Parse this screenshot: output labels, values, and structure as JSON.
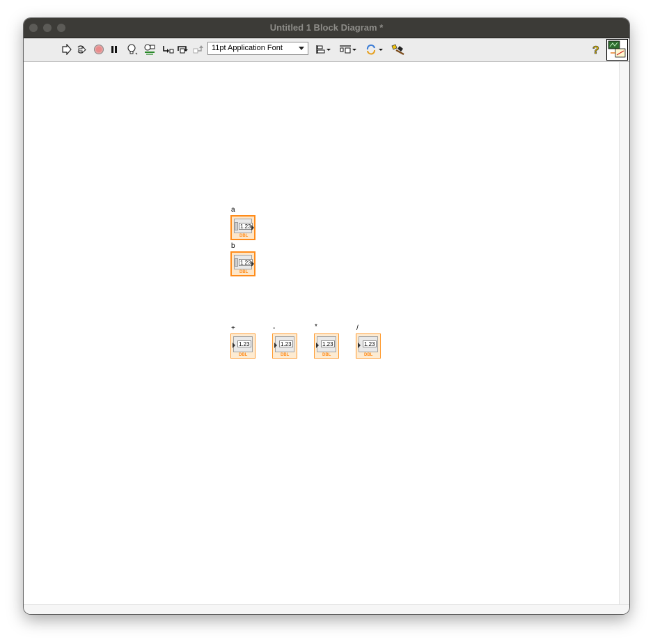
{
  "window": {
    "title": "Untitled 1 Block Diagram *"
  },
  "toolbar": {
    "icons": [
      {
        "name": "run-arrow-icon"
      },
      {
        "name": "run-continuously-icon"
      },
      {
        "name": "abort-execution-icon"
      },
      {
        "name": "pause-icon"
      },
      {
        "name": "highlight-execution-icon"
      },
      {
        "name": "retain-wire-values-icon"
      },
      {
        "name": "step-into-icon"
      },
      {
        "name": "step-over-icon"
      },
      {
        "name": "step-out-icon"
      },
      {
        "name": "align-objects-icon"
      },
      {
        "name": "distribute-objects-icon"
      },
      {
        "name": "reorder-icon"
      },
      {
        "name": "cleanup-diagram-icon"
      },
      {
        "name": "context-help-icon"
      }
    ],
    "font_select": {
      "value": "11pt Application Font"
    }
  },
  "diagram": {
    "controls": [
      {
        "label": "a",
        "value": "1.23",
        "type": "DBL"
      },
      {
        "label": "b",
        "value": "1.23",
        "type": "DBL"
      }
    ],
    "indicators": [
      {
        "label": "+",
        "value": "1.23",
        "type": "DBL"
      },
      {
        "label": "-",
        "value": "1.23",
        "type": "DBL"
      },
      {
        "label": "*",
        "value": "1.23",
        "type": "DBL"
      },
      {
        "label": "/",
        "value": "1.23",
        "type": "DBL"
      }
    ]
  },
  "colors": {
    "accent_orange": "#ff8c1a",
    "titlebar": "#3c3b37"
  }
}
